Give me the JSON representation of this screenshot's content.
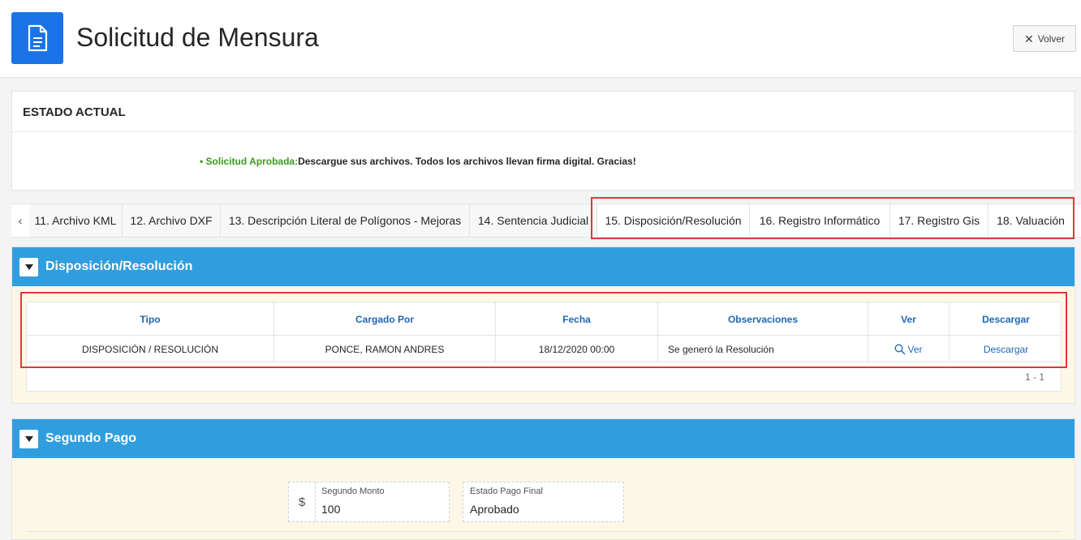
{
  "header": {
    "title": "Solicitud de Mensura",
    "icon": "document-icon",
    "back_label": "Volver"
  },
  "estado": {
    "title": "ESTADO ACTUAL",
    "status_prefix": "• Solicitud Aprobada:",
    "status_text": "Descargue sus archivos. Todos los archivos llevan firma digital. Gracias!",
    "status_color": "#3a9a1f"
  },
  "tabs": [
    {
      "label": "11. Archivo KML"
    },
    {
      "label": "12. Archivo DXF"
    },
    {
      "label": "13. Descripción Literal de Polígonos - Mejoras"
    },
    {
      "label": "14. Sentencia Judicial"
    },
    {
      "label": "15. Disposición/Resolución"
    },
    {
      "label": "16. Registro Informático"
    },
    {
      "label": "17. Registro Gis"
    },
    {
      "label": "18. Valuación"
    }
  ],
  "disposicion": {
    "title": "Disposición/Resolución",
    "columns": [
      "Tipo",
      "Cargado Por",
      "Fecha",
      "Observaciones",
      "Ver",
      "Descargar"
    ],
    "rows": [
      {
        "tipo": "DISPOSICIÓN / RESOLUCIÓN",
        "cargado_por": "PONCE, RAMON ANDRES",
        "fecha": "18/12/2020 00:00",
        "observaciones": "Se generó la Resolución",
        "ver": "Ver",
        "descargar": "Descargar"
      }
    ],
    "pagination": "1 - 1"
  },
  "segundo_pago": {
    "title": "Segundo Pago",
    "monto_label": "Segundo Monto",
    "monto_prefix": "$",
    "monto_value": "100",
    "estado_label": "Estado Pago Final",
    "estado_value": "Aprobado"
  },
  "colors": {
    "accent": "#1a73e8",
    "region_header": "#309ede",
    "link": "#1d67b6",
    "highlight": "#e3363c",
    "region_body": "#fdf8e6"
  }
}
